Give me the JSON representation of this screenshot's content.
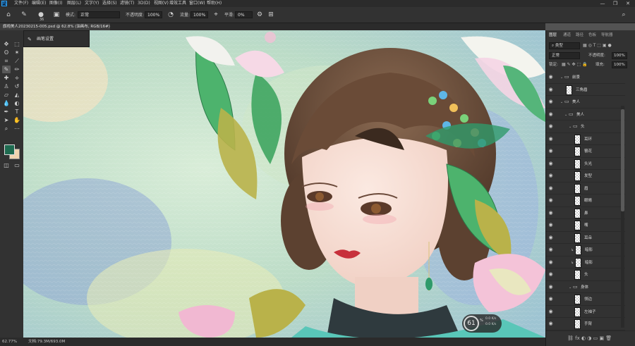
{
  "app": {
    "logo": "Ps"
  },
  "menu": [
    "文件(F)",
    "编辑(E)",
    "图像(I)",
    "图层(L)",
    "文字(Y)",
    "选择(S)",
    "滤镜(T)",
    "3D(D)",
    "视图(V)",
    "增效工具",
    "窗口(W)",
    "帮助(H)"
  ],
  "window_controls": {
    "minimize": "—",
    "restore": "❐",
    "close": "✕"
  },
  "options": {
    "brush_size": "36",
    "mode_label": "模式:",
    "mode_value": "正常",
    "opacity_label": "不透明度:",
    "opacity_value": "100%",
    "flow_label": "流量:",
    "flow_value": "100%",
    "smoothing_label": "平滑:",
    "smoothing_value": "0%"
  },
  "document": {
    "tab_title": "旗袍美人20230215-005.psd @ 62.8% (油画布, RGB/16#) *"
  },
  "brush_panel": {
    "title": "画笔设置"
  },
  "status": {
    "zoom": "62.77%",
    "doc_size": "文档:79.3M/693.0M"
  },
  "zoom_widget": {
    "value": "61",
    "unit": "%",
    "sub": "0.0 K/s",
    "sub2": "0.0 K/s"
  },
  "colors": {
    "foreground": "#1e6b50",
    "background": "#f0d4b0",
    "accent": "#31a8ff"
  },
  "layers_panel": {
    "tabs": [
      "图层",
      "通道",
      "路径",
      "色板",
      "导航器"
    ],
    "filter_label": "类型",
    "blend_mode": "正常",
    "opacity_label": "不透明度:",
    "opacity_value": "100%",
    "lock_label": "锁定:",
    "fill_label": "填充:",
    "fill_value": "100%",
    "layers": [
      {
        "name": "前景",
        "type": "folder",
        "indent": 1
      },
      {
        "name": "三角眉",
        "type": "layer",
        "indent": 2
      },
      {
        "name": "美人",
        "type": "folder",
        "indent": 1
      },
      {
        "name": "美人",
        "type": "folder",
        "indent": 2
      },
      {
        "name": "头",
        "type": "folder",
        "indent": 3
      },
      {
        "name": "耳环",
        "type": "layer",
        "indent": 4
      },
      {
        "name": "簪花",
        "type": "layer",
        "indent": 4
      },
      {
        "name": "头光",
        "type": "layer",
        "indent": 4
      },
      {
        "name": "发型",
        "type": "layer",
        "indent": 4
      },
      {
        "name": "眉",
        "type": "layer",
        "indent": 4
      },
      {
        "name": "眼睛",
        "type": "layer",
        "indent": 4
      },
      {
        "name": "鼻",
        "type": "layer",
        "indent": 4
      },
      {
        "name": "嘴",
        "type": "layer",
        "indent": 4
      },
      {
        "name": "耳朵",
        "type": "layer",
        "indent": 4
      },
      {
        "name": "暗影",
        "type": "layer",
        "indent": 4,
        "clip": true
      },
      {
        "name": "暗影",
        "type": "layer",
        "indent": 4,
        "clip": true
      },
      {
        "name": "头",
        "type": "layer",
        "indent": 4
      },
      {
        "name": "身体",
        "type": "folder",
        "indent": 3
      },
      {
        "name": "领边",
        "type": "layer",
        "indent": 4
      },
      {
        "name": "左袖子",
        "type": "layer",
        "indent": 4
      },
      {
        "name": "手臂",
        "type": "layer",
        "indent": 4
      }
    ]
  }
}
